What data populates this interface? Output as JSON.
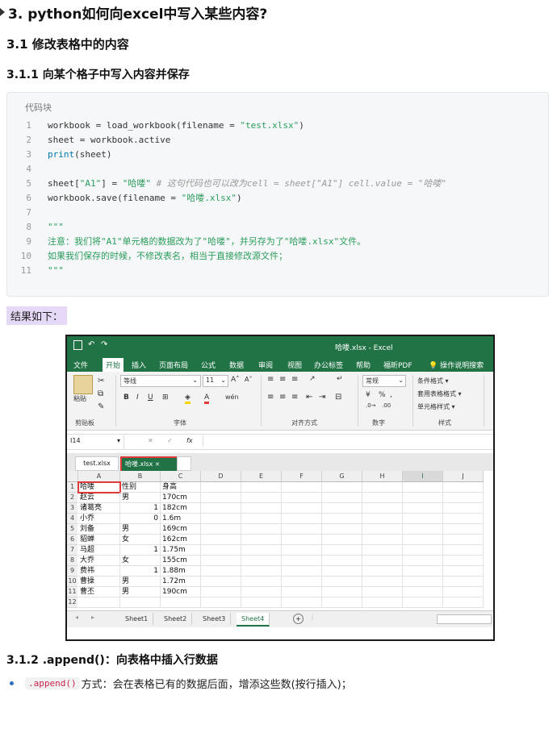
{
  "headings": {
    "h2": "3. python如何向excel中写入某些内容?",
    "h3": "3.1 修改表格中的内容",
    "h4": "3.1.1 向某个格子中写入内容并保存",
    "h4b": "3.1.2 .append()：向表格中插入行数据"
  },
  "code": {
    "caption": "代码块",
    "lines": [
      {
        "n": "1",
        "parts": [
          [
            "plain",
            "workbook = load_workbook(filename = "
          ],
          [
            "str",
            "\"test.xlsx\""
          ],
          [
            "plain",
            ")"
          ]
        ]
      },
      {
        "n": "2",
        "parts": [
          [
            "plain",
            "sheet = workbook.active"
          ]
        ]
      },
      {
        "n": "3",
        "parts": [
          [
            "kw",
            "print"
          ],
          [
            "plain",
            "(sheet)"
          ]
        ]
      },
      {
        "n": "4",
        "parts": []
      },
      {
        "n": "5",
        "parts": [
          [
            "plain",
            "sheet["
          ],
          [
            "str",
            "\"A1\""
          ],
          [
            "plain",
            "] = "
          ],
          [
            "str",
            "\"哈喽\""
          ],
          [
            "cm",
            " # 这句代码也可以改为cell = sheet[\"A1\"] cell.value = \"哈喽\""
          ]
        ]
      },
      {
        "n": "6",
        "parts": [
          [
            "plain",
            "workbook.save(filename = "
          ],
          [
            "str",
            "\"哈喽.xlsx\""
          ],
          [
            "plain",
            ")"
          ]
        ]
      },
      {
        "n": "7",
        "parts": []
      },
      {
        "n": "8",
        "parts": [
          [
            "doc",
            "\"\"\""
          ]
        ]
      },
      {
        "n": "9",
        "parts": [
          [
            "doc",
            "注意：我们将\"A1\"单元格的数据改为了\"哈喽\"，并另存为了\"哈喽.xlsx\"文件。"
          ]
        ]
      },
      {
        "n": "10",
        "parts": [
          [
            "doc",
            "如果我们保存的时候，不修改表名，相当于直接修改源文件；"
          ]
        ]
      },
      {
        "n": "11",
        "parts": [
          [
            "doc",
            "\"\"\""
          ]
        ]
      }
    ]
  },
  "result_label": "结果如下：",
  "excel": {
    "title": "哈喽.xlsx  -  Excel",
    "tabs": [
      "文件",
      "开始",
      "插入",
      "页面布局",
      "公式",
      "数据",
      "审阅",
      "视图",
      "办公标签",
      "帮助",
      "福昕PDF",
      "操作说明搜索"
    ],
    "ribbon": {
      "paste": "粘贴",
      "clipboard": "剪贴板",
      "font_name": "等线",
      "font_size": "11",
      "font_group": "字体",
      "align_group": "对齐方式",
      "number_format": "常规",
      "number_group": "数字",
      "cond_format": "条件格式",
      "table_format": "套用表格格式",
      "cell_style": "单元格样式",
      "style_group": "样式"
    },
    "name_box": "I14",
    "fx": "fx",
    "file_tabs": [
      "test.xlsx",
      "哈喽.xlsx"
    ],
    "columns": [
      "A",
      "B",
      "C",
      "D",
      "E",
      "F",
      "G",
      "H",
      "I",
      "J"
    ],
    "rows": [
      [
        "哈喽",
        "性别",
        "身高"
      ],
      [
        "赵云",
        "男",
        "170cm"
      ],
      [
        "诸葛亮",
        "1",
        "182cm"
      ],
      [
        "小乔",
        "0",
        "1.6m"
      ],
      [
        "刘备",
        "男",
        "169cm"
      ],
      [
        "貂蝉",
        "女",
        "162cm"
      ],
      [
        "马超",
        "1",
        "1.75m"
      ],
      [
        "大乔",
        "女",
        "155cm"
      ],
      [
        "费祎",
        "1",
        "1.88m"
      ],
      [
        "曹操",
        "男",
        "1.72m"
      ],
      [
        "曹丕",
        "男",
        "190cm"
      ],
      [
        "",
        "",
        ""
      ]
    ],
    "sheets": [
      "Sheet1",
      "Sheet2",
      "Sheet3",
      "Sheet4"
    ],
    "active_sheet": "Sheet4",
    "colors": {
      "green": "#217346",
      "highlight": "#e03a3a"
    }
  },
  "bullet": {
    "code": ".append()",
    "text": "方式：会在表格已有的数据后面，增添这些数(按行插入)；"
  }
}
